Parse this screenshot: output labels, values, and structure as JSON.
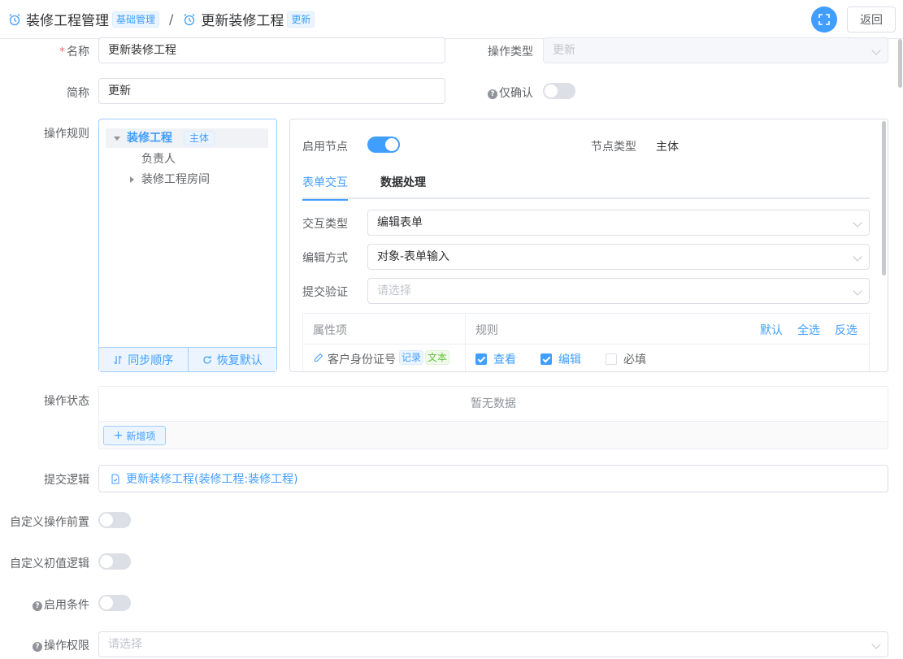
{
  "header": {
    "crumb1": "装修工程管理",
    "crumb1_tag": "基础管理",
    "separator": "/",
    "crumb2": "更新装修工程",
    "crumb2_tag": "更新",
    "back_label": "返回"
  },
  "form": {
    "name_label": "名称",
    "name_value": "更新装修工程",
    "op_type_label": "操作类型",
    "op_type_value": "更新",
    "short_label": "简称",
    "short_value": "更新",
    "confirm_only_label": "仅确认",
    "confirm_only_on": false,
    "rules_label": "操作规则",
    "state_label": "操作状态",
    "submit_logic_label": "提交逻辑",
    "custom_pre_label": "自定义操作前置",
    "custom_pre_on": false,
    "custom_init_label": "自定义初值逻辑",
    "custom_init_on": false,
    "enable_cond_label": "启用条件",
    "enable_cond_on": false,
    "permission_label": "操作权限",
    "permission_placeholder": "请选择"
  },
  "tree": {
    "root_label": "装修工程",
    "root_tag": "主体",
    "child1": "负责人",
    "child2": "装修工程房间",
    "sync_label": "同步顺序",
    "reset_label": "恢复默认"
  },
  "panel": {
    "enable_node_label": "启用节点",
    "enable_node_on": true,
    "node_type_label": "节点类型",
    "node_type_value": "主体",
    "tab1": "表单交互",
    "tab2": "数据处理",
    "interact_label": "交互类型",
    "interact_value": "编辑表单",
    "edit_mode_label": "编辑方式",
    "edit_mode_value": "对象-表单输入",
    "validate_label": "提交验证",
    "validate_placeholder": "请选择",
    "table": {
      "col_attr": "属性项",
      "col_rule": "规则",
      "default_label": "默认",
      "select_all_label": "全选",
      "invert_label": "反选",
      "row_attr": "客户身份证号",
      "row_tag1": "记录",
      "row_tag2": "文本",
      "view_label": "查看",
      "view_checked": true,
      "edit_label": "编辑",
      "edit_checked": true,
      "required_label": "必填",
      "required_checked": false
    }
  },
  "state": {
    "empty_text": "暂无数据",
    "add_label": "新增项"
  },
  "submit_logic": {
    "link_text": "更新装修工程(装修工程:装修工程)"
  },
  "colors": {
    "primary": "#409eff",
    "required": "#f56c6c",
    "success": "#67c23a"
  }
}
